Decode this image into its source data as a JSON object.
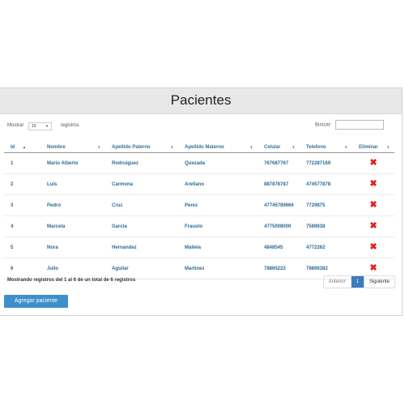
{
  "title": "Pacientes",
  "length_menu": {
    "label_before": "Mostrar",
    "value": "10",
    "label_after": "registros"
  },
  "search": {
    "label": "Buscar:",
    "value": ""
  },
  "columns": [
    "Id",
    "Nombre",
    "Apellido Paterno",
    "Apellido Materno",
    "Celular",
    "Telefono",
    "Eliminar"
  ],
  "rows": [
    [
      "1",
      "Mario Alberto",
      "Rodruiguez",
      "Quezada",
      "767687767",
      "772287169"
    ],
    [
      "2",
      "Luis",
      "Carmona",
      "Arellano",
      "887878787",
      "474577878"
    ],
    [
      "3",
      "Pedro",
      "Cruz",
      "Perez",
      "47745789666",
      "7729875"
    ],
    [
      "4",
      "Marcela",
      "Garcia",
      "Frausto",
      "4775008000",
      "7589638"
    ],
    [
      "5",
      "Nora",
      "Hernandez",
      "Mallela",
      "4848545",
      "4772262"
    ],
    [
      "6",
      "Julio",
      "Aguilar",
      "Martinez",
      "78865222",
      "78896382"
    ]
  ],
  "delete_icon": "x-icon",
  "info_text": "Mostrando registros del 1 al 6 de un total de 6 registros",
  "pagination": {
    "previous": "Anterior",
    "current": "1",
    "next": "Siguiente"
  },
  "add_button": "Agregar paciente",
  "colors": {
    "header_bg": "#e8e8e8",
    "link": "#2c6b93",
    "button": "#3e8fca",
    "delete": "#e0201f"
  }
}
